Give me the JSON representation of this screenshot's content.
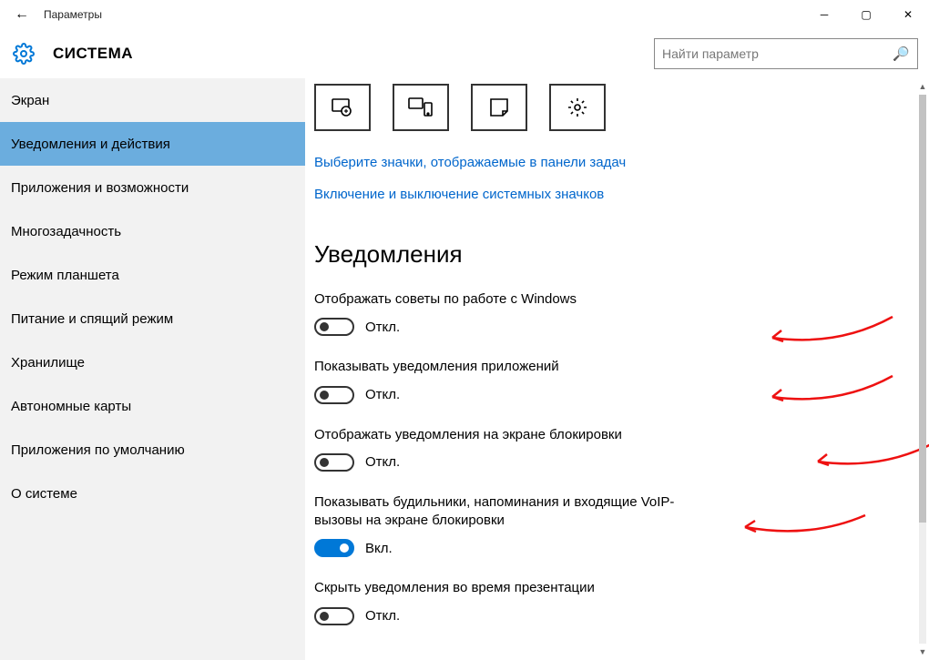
{
  "window": {
    "title": "Параметры"
  },
  "section_title": "СИСТЕМА",
  "search_placeholder": "Найти параметр",
  "sidebar": {
    "items": [
      {
        "label": "Экран",
        "active": false
      },
      {
        "label": "Уведомления и действия",
        "active": true
      },
      {
        "label": "Приложения и возможности",
        "active": false
      },
      {
        "label": "Многозадачность",
        "active": false
      },
      {
        "label": "Режим планшета",
        "active": false
      },
      {
        "label": "Питание и спящий режим",
        "active": false
      },
      {
        "label": "Хранилище",
        "active": false
      },
      {
        "label": "Автономные карты",
        "active": false
      },
      {
        "label": "Приложения по умолчанию",
        "active": false
      },
      {
        "label": "О системе",
        "active": false
      }
    ]
  },
  "quick_actions": [
    {
      "icon": "tablet-mode-icon"
    },
    {
      "icon": "project-icon"
    },
    {
      "icon": "note-icon"
    },
    {
      "icon": "settings-gear-icon"
    }
  ],
  "links": {
    "taskbar_icons": "Выберите значки, отображаемые в панели задач",
    "system_icons": "Включение и выключение системных значков"
  },
  "notifications_title": "Уведомления",
  "toggles": [
    {
      "label": "Отображать советы по работе с Windows",
      "state": "Откл.",
      "on": false
    },
    {
      "label": "Показывать уведомления приложений",
      "state": "Откл.",
      "on": false
    },
    {
      "label": "Отображать уведомления на экране блокировки",
      "state": "Откл.",
      "on": false
    },
    {
      "label": "Показывать будильники, напоминания и входящие VoIP-вызовы на экране блокировки",
      "state": "Вкл.",
      "on": true
    },
    {
      "label": "Скрыть уведомления во время презентации",
      "state": "Откл.",
      "on": false
    }
  ]
}
